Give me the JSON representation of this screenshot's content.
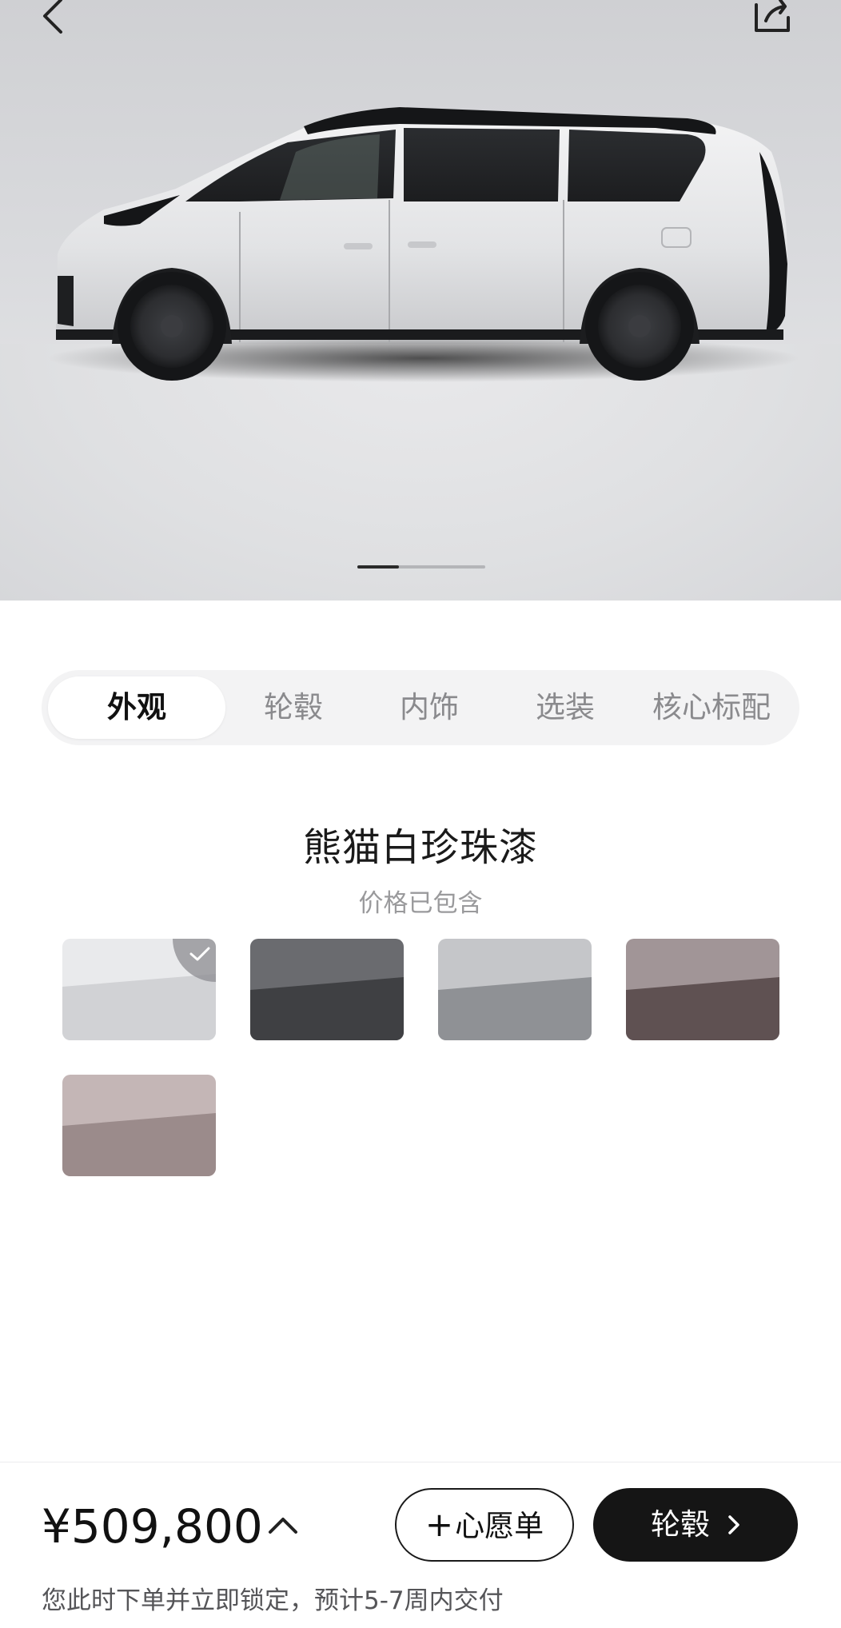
{
  "header": {
    "back_icon": "chevron-left-icon",
    "share_icon": "share-icon"
  },
  "gallery": {
    "page_count": 3,
    "current_page": 1
  },
  "tabs": [
    {
      "label": "外观",
      "active": true
    },
    {
      "label": "轮毂",
      "active": false
    },
    {
      "label": "内饰",
      "active": false
    },
    {
      "label": "选装",
      "active": false
    },
    {
      "label": "核心标配",
      "active": false
    }
  ],
  "paint": {
    "selected_name": "熊猫白珍珠漆",
    "price_note": "价格已包含",
    "swatches": [
      {
        "color": "#d7d8db",
        "selected": true
      },
      {
        "color": "#4e4f52",
        "selected": false
      },
      {
        "color": "#9a9ca0",
        "selected": false
      },
      {
        "color": "#6e5f60",
        "selected": false
      },
      {
        "color": "#a9999a",
        "selected": false
      }
    ]
  },
  "footer": {
    "price": "¥509,800",
    "price_toggle_icon": "chevron-up-icon",
    "wishlist_label": "心愿单",
    "wishlist_icon": "plus-icon",
    "next_label": "轮毂",
    "next_icon": "chevron-right-icon",
    "delivery_note": "您此时下单并立即锁定，预计5-7周内交付"
  },
  "colors": {
    "primary_button": "#151515",
    "tab_track": "#f3f3f4",
    "muted_text": "#9a9a9c"
  }
}
